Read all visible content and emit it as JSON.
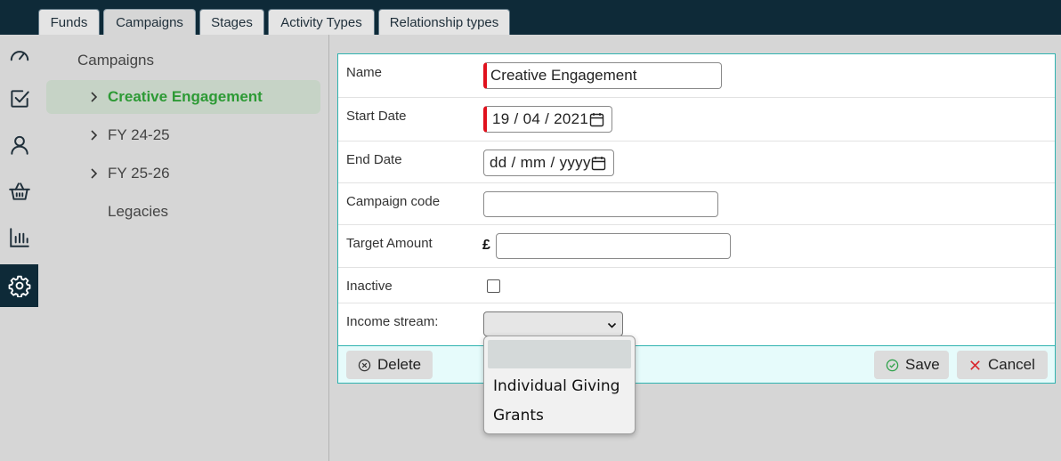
{
  "tabs": [
    {
      "label": "Funds",
      "active": false
    },
    {
      "label": "Campaigns",
      "active": true
    },
    {
      "label": "Stages",
      "active": false
    },
    {
      "label": "Activity Types",
      "active": false
    },
    {
      "label": "Relationship types",
      "active": false
    }
  ],
  "rail": [
    {
      "icon": "dashboard-gauge-icon",
      "active": false
    },
    {
      "icon": "tasks-checkbox-icon",
      "active": false
    },
    {
      "icon": "user-icon",
      "active": false
    },
    {
      "icon": "basket-icon",
      "active": false
    },
    {
      "icon": "bar-chart-icon",
      "active": false
    },
    {
      "icon": "gear-icon",
      "active": true
    }
  ],
  "tree": {
    "root_label": "Campaigns",
    "items": [
      {
        "label": "Creative Engagement",
        "selected": true,
        "expandable": true
      },
      {
        "label": "FY 24-25",
        "selected": false,
        "expandable": true
      },
      {
        "label": "FY 25-26",
        "selected": false,
        "expandable": true
      },
      {
        "label": "Legacies",
        "selected": false,
        "expandable": false
      }
    ]
  },
  "form": {
    "name_label": "Name",
    "name_value": "Creative Engagement",
    "start_date_label": "Start Date",
    "start_date_value": "19 / 04 / 2021",
    "end_date_label": "End Date",
    "end_date_placeholder": "dd / mm / yyyy",
    "campaign_code_label": "Campaign code",
    "campaign_code_value": "",
    "target_amount_label": "Target Amount",
    "currency_symbol": "£",
    "target_amount_value": "",
    "inactive_label": "Inactive",
    "inactive_checked": false,
    "income_stream_label": "Income stream:",
    "income_stream_value": "",
    "income_stream_options": [
      "",
      "Individual Giving",
      "Grants"
    ]
  },
  "buttons": {
    "delete": "Delete",
    "save": "Save",
    "cancel": "Cancel"
  },
  "colors": {
    "topbar": "#0e2a38",
    "accent_teal": "#2fb3b0",
    "selected_green": "#2d9a35",
    "required_red": "#e0101c",
    "cancel_red": "#d9262c",
    "save_green": "#2fa24b"
  }
}
